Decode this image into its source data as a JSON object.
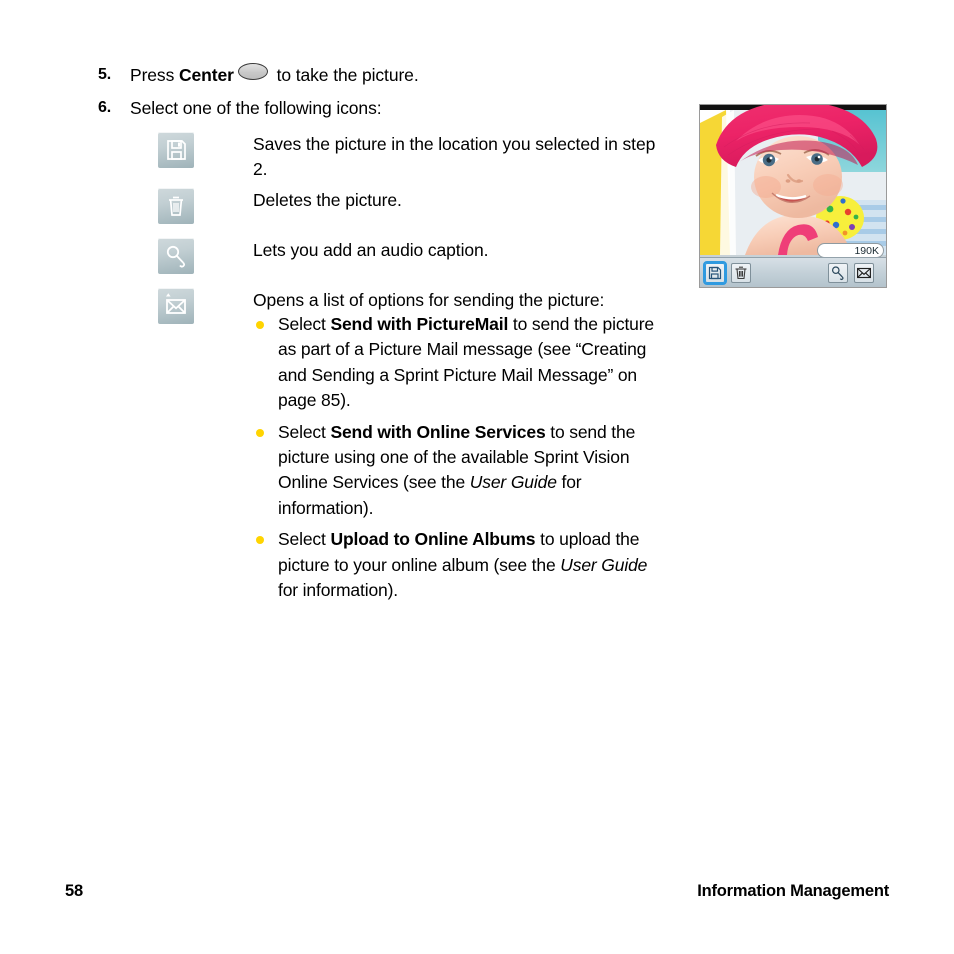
{
  "page": {
    "number": "58",
    "section_title": "Information Management"
  },
  "steps": [
    {
      "number": "5.",
      "text_before": "Press ",
      "bold": "Center",
      "key_icon": "center-key-icon",
      "text_after": " to take the picture."
    },
    {
      "number": "6.",
      "text_before": "Select one of the following icons:",
      "bold": "",
      "text_after": ""
    }
  ],
  "icon_rows": [
    {
      "icon": "save-floppy-icon",
      "description": "Saves the picture in the location you selected in step 2."
    },
    {
      "icon": "trash-icon",
      "description": "Deletes the picture."
    },
    {
      "icon": "microphone-icon",
      "description": "Lets you add an audio caption."
    },
    {
      "icon": "envelope-send-icon",
      "description": "Opens a list of options for sending the picture:"
    }
  ],
  "bullets": [
    {
      "lead": "Select ",
      "bold": "Send with PictureMail",
      "rest": " to send the picture as part of a Picture Mail message (see “Creating and Sending a Sprint Picture Mail Message” on page 85)."
    },
    {
      "lead": "Select ",
      "bold": "Send with Online Services",
      "rest_1": " to send the picture using one of the available Sprint Vision Online Services (see the ",
      "italic": "User Guide",
      "rest_2": " for information)."
    },
    {
      "lead": "Select ",
      "bold": "Upload to Online Albums",
      "rest_1": " to upload the picture to your online album (see the ",
      "italic": "User Guide",
      "rest_2": " for information)."
    }
  ],
  "phone_screenshot": {
    "alt": "phone camera review screen showing baby in pink hat",
    "file_size_label": "190K",
    "toolbar": [
      {
        "icon": "save-floppy-icon",
        "selected": true
      },
      {
        "icon": "trash-icon",
        "selected": false
      },
      {
        "icon": "microphone-icon",
        "selected": false
      },
      {
        "icon": "envelope-send-icon",
        "selected": false
      }
    ]
  },
  "colors": {
    "bullet": "#FFD400",
    "icon_gradient_top": "#cfd9dc",
    "icon_gradient_bottom": "#9fb3b9",
    "selection_blue": "#2f9ae0",
    "hat_pink": "#ef2f6e",
    "background_yellow": "#f5d83a",
    "background_teal": "#5ec4cf"
  }
}
